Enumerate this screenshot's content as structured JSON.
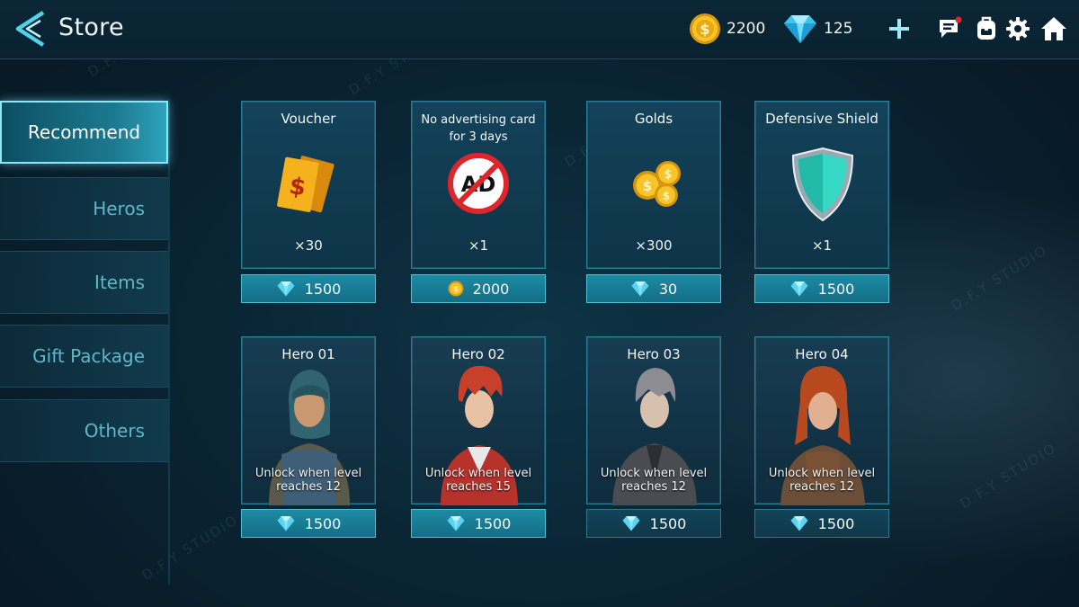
{
  "header": {
    "title": "Store",
    "gold_amount": "2200",
    "gem_amount": "125"
  },
  "sidebar": {
    "tabs": [
      {
        "label": "Recommend",
        "active": true
      },
      {
        "label": "Heros",
        "active": false
      },
      {
        "label": "Items",
        "active": false
      },
      {
        "label": "Gift Package",
        "active": false
      },
      {
        "label": "Others",
        "active": false
      }
    ]
  },
  "items": [
    {
      "title": "Voucher",
      "quantity": "×30",
      "price": "1500",
      "currency": "gem"
    },
    {
      "title_line1": "No advertising card",
      "title_line2": "for 3 days",
      "badge": "AD",
      "quantity": "×1",
      "price": "2000",
      "currency": "gold"
    },
    {
      "title": "Golds",
      "quantity": "×300",
      "price": "30",
      "currency": "gem"
    },
    {
      "title": "Defensive Shield",
      "quantity": "×1",
      "price": "1500",
      "currency": "gem"
    }
  ],
  "heroes": [
    {
      "title": "Hero 01",
      "unlock_line1": "Unlock when level",
      "unlock_line2": "reaches 12",
      "price": "1500"
    },
    {
      "title": "Hero 02",
      "unlock_line1": "Unlock when level",
      "unlock_line2": "reaches 15",
      "price": "1500"
    },
    {
      "title": "Hero 03",
      "unlock_line1": "Unlock when level",
      "unlock_line2": "reaches 12",
      "price": "1500"
    },
    {
      "title": "Hero 04",
      "unlock_line1": "Unlock when level",
      "unlock_line2": "reaches 12",
      "price": "1500"
    }
  ],
  "watermark": "D.F.Y STUDIO",
  "colors": {
    "accent": "#2ea3bb",
    "gem": "#5ad4f2",
    "gold": "#f2b81c",
    "shield": "#34d8c4",
    "notification": "#e0242c"
  },
  "icons": {
    "back": "back-arrow-icon",
    "gold": "gold-coin-icon",
    "gem": "diamond-icon",
    "add": "plus-icon",
    "chat": "chat-icon",
    "bag": "backpack-icon",
    "settings": "gear-icon",
    "home": "home-icon"
  }
}
